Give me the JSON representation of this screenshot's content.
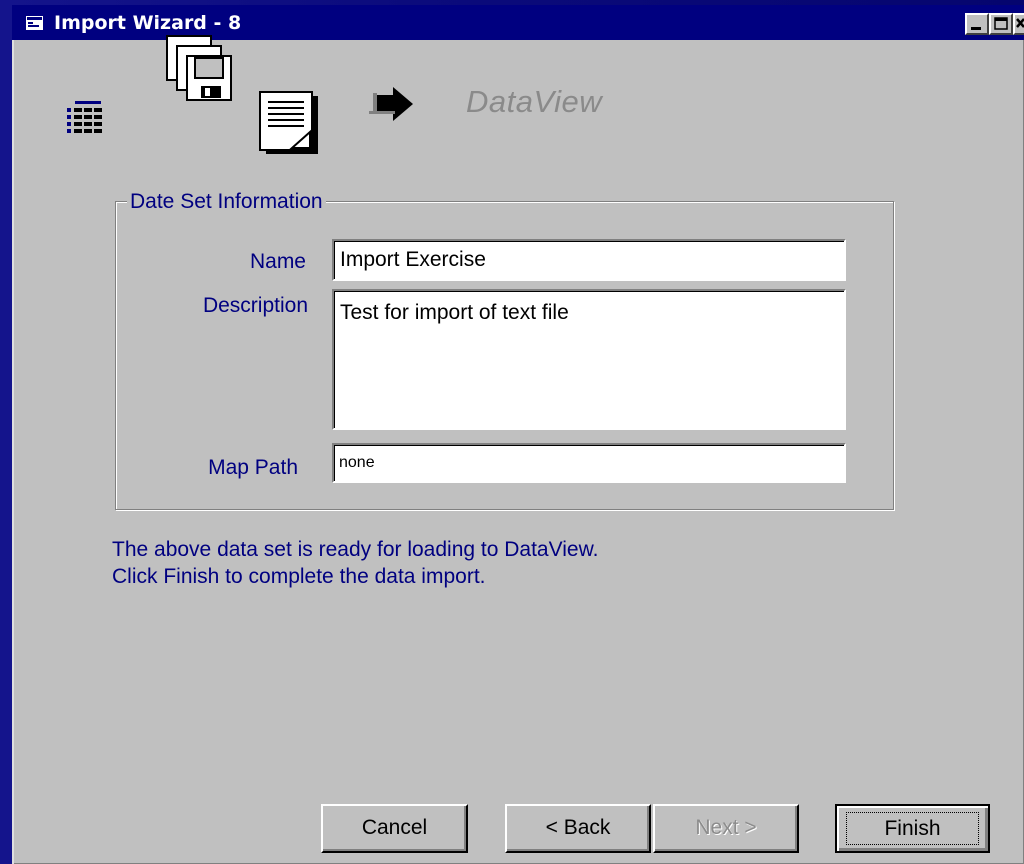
{
  "window": {
    "title": "Import Wizard - 8"
  },
  "header": {
    "brand": "DataView",
    "icons": [
      "table-icon",
      "floppy-disks-icon",
      "document-icon",
      "right-arrow-icon"
    ]
  },
  "dataset": {
    "legend": "Date Set Information",
    "name_label": "Name",
    "name_value": "Import Exercise",
    "description_label": "Description",
    "description_value": "Test for import of text file",
    "map_path_label": "Map Path",
    "map_path_value": "none"
  },
  "info": {
    "line1": "The above data set is ready for loading to DataView.",
    "line2": "Click  Finish to complete the data import."
  },
  "buttons": {
    "cancel": "Cancel",
    "back": "< Back",
    "next": "Next >",
    "finish": "Finish"
  },
  "colors": {
    "desktop": "#0a0a78",
    "titlebar": "#000080",
    "face": "#c0c0c0",
    "label_text": "#000080"
  }
}
